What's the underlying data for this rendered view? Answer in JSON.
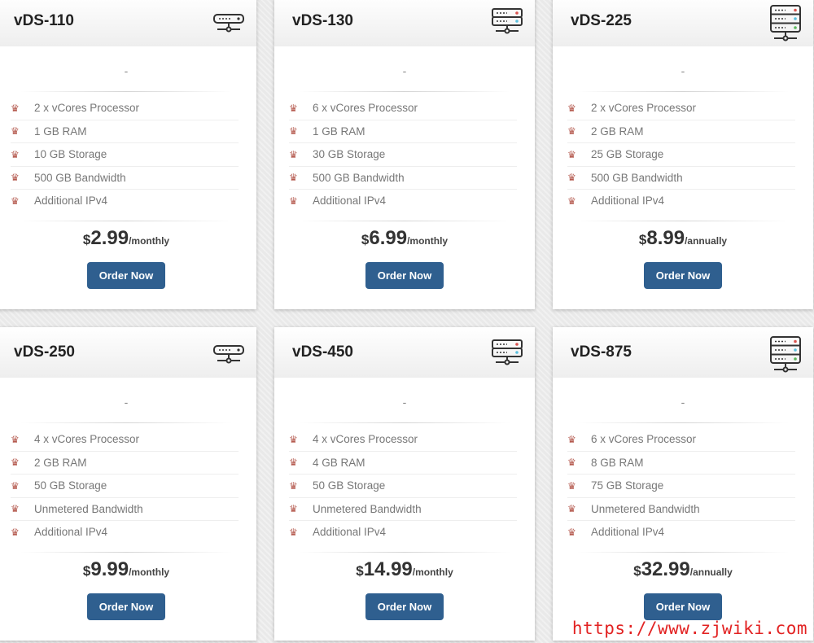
{
  "plans": [
    {
      "name": "vDS-110",
      "icon": "server-1u-icon",
      "features": [
        "2 x vCores Processor",
        "1 GB RAM",
        "10 GB Storage",
        "500 GB Bandwidth",
        "Additional IPv4"
      ],
      "currency": "$",
      "price": "2.99",
      "period": "/monthly",
      "cta": "Order Now",
      "subtitle": "-"
    },
    {
      "name": "vDS-130",
      "icon": "server-2u-icon",
      "features": [
        "6 x vCores Processor",
        "1 GB RAM",
        "30 GB Storage",
        "500 GB Bandwidth",
        "Additional IPv4"
      ],
      "currency": "$",
      "price": "6.99",
      "period": "/monthly",
      "cta": "Order Now",
      "subtitle": "-"
    },
    {
      "name": "vDS-225",
      "icon": "server-3u-icon",
      "features": [
        "2 x vCores Processor",
        "2 GB RAM",
        "25 GB Storage",
        "500 GB Bandwidth",
        "Additional IPv4"
      ],
      "currency": "$",
      "price": "8.99",
      "period": "/annually",
      "cta": "Order Now",
      "subtitle": "-"
    },
    {
      "name": "vDS-250",
      "icon": "server-1u-icon",
      "features": [
        "4 x vCores Processor",
        "2 GB RAM",
        "50 GB Storage",
        "Unmetered Bandwidth",
        "Additional IPv4"
      ],
      "currency": "$",
      "price": "9.99",
      "period": "/monthly",
      "cta": "Order Now",
      "subtitle": "-"
    },
    {
      "name": "vDS-450",
      "icon": "server-2u-icon",
      "features": [
        "4 x vCores Processor",
        "4 GB RAM",
        "50 GB Storage",
        "Unmetered Bandwidth",
        "Additional IPv4"
      ],
      "currency": "$",
      "price": "14.99",
      "period": "/monthly",
      "cta": "Order Now",
      "subtitle": "-"
    },
    {
      "name": "vDS-875",
      "icon": "server-3u-icon",
      "features": [
        "6 x vCores Processor",
        "8 GB RAM",
        "75 GB Storage",
        "Unmetered Bandwidth",
        "Additional IPv4"
      ],
      "currency": "$",
      "price": "32.99",
      "period": "/annually",
      "cta": "Order Now",
      "subtitle": "-"
    }
  ],
  "bullet_glyph": "♛",
  "colors": {
    "button": "#2f5f8f",
    "bullet": "#b55a4f",
    "watermark": "#e22222"
  },
  "watermark": "https://www.zjwiki.com"
}
